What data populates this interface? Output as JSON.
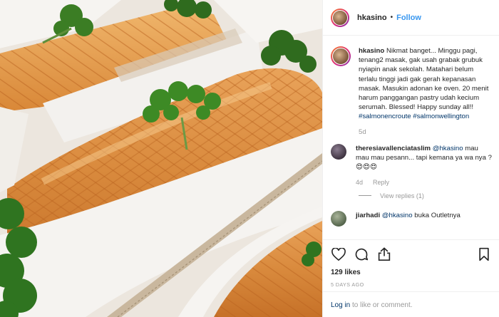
{
  "header": {
    "username": "hkasino",
    "separator": "•",
    "follow_label": "Follow"
  },
  "caption": {
    "username": "hkasino",
    "text": "Nikmat banget... Minggu pagi, tenang2 masak, gak usah grabak grubuk nyiapin anak sekolah. Matahari belum terlalu tinggi jadi gak gerah kepanasan masak. Masukin adonan ke oven. 20 menit harum panggangan pastry udah kecium serumah. Blessed! Happy sunday all!!",
    "hashtags": "#salmonencroute #salmonwellington",
    "age": "5d"
  },
  "comments": [
    {
      "username": "theresiavallenciataslim",
      "mention": "@hkasino",
      "text": "mau mau mau pesann... tapi kemana ya wa nya ?",
      "emojis": "😍😍😍",
      "age": "4d",
      "reply_label": "Reply",
      "view_replies": "View replies (1)"
    },
    {
      "username": "jiarhadi",
      "mention": "@hkasino",
      "text": "buka Outletnya"
    }
  ],
  "actions": {
    "icons": [
      "heart-icon",
      "comment-icon",
      "share-icon",
      "bookmark-icon"
    ],
    "likes": "129 likes",
    "date": "5 DAYS AGO"
  },
  "login": {
    "link": "Log in",
    "text": "to like or comment."
  },
  "colors": {
    "link_blue": "#3897f0",
    "hashtag_blue": "#003569",
    "muted": "#999999",
    "border": "#efefef"
  }
}
